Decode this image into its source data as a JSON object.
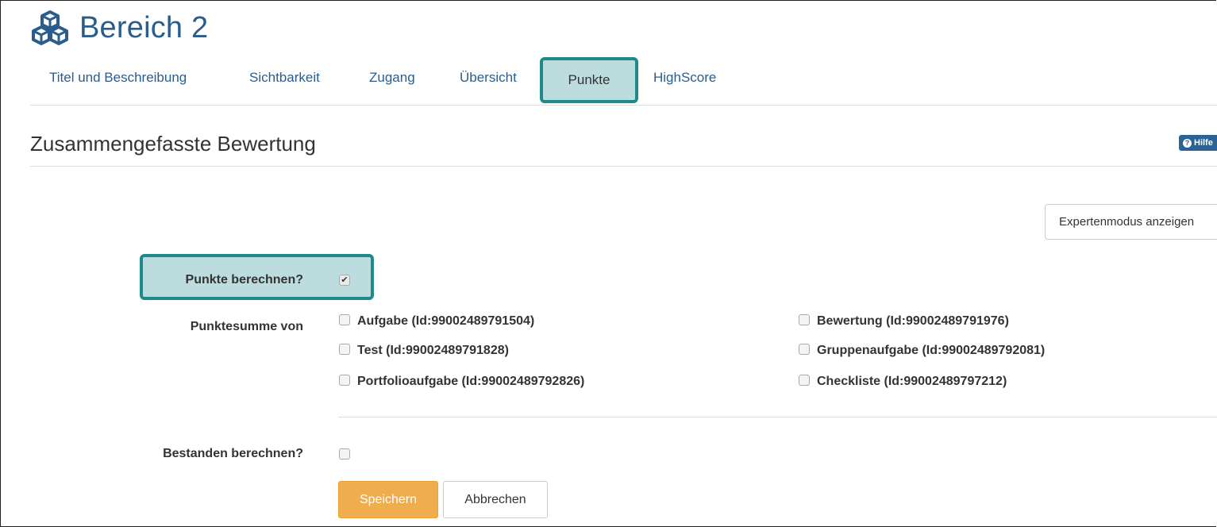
{
  "header": {
    "title": "Bereich 2",
    "icon": "cubes-icon"
  },
  "tabs": [
    {
      "label": "Titel und Beschreibung"
    },
    {
      "label": "Sichtbarkeit"
    },
    {
      "label": "Zugang"
    },
    {
      "label": "Übersicht"
    },
    {
      "label": "Punkte"
    },
    {
      "label": "HighScore"
    }
  ],
  "active_tab": "Punkte",
  "section": {
    "title": "Zusammengefasste Bewertung",
    "help_label": "Hilfe"
  },
  "expert_button": "Expertenmodus anzeigen",
  "form": {
    "calc_points_label": "Punkte berechnen?",
    "calc_points_checked": true,
    "sum_label": "Punktesumme von",
    "options": [
      {
        "label": "Aufgabe (Id:99002489791504)",
        "checked": false
      },
      {
        "label": "Test (Id:99002489791828)",
        "checked": false
      },
      {
        "label": "Portfolioaufgabe (Id:99002489792826)",
        "checked": false
      },
      {
        "label": "Bewertung (Id:99002489791976)",
        "checked": false
      },
      {
        "label": "Gruppenaufgabe (Id:99002489792081)",
        "checked": false
      },
      {
        "label": "Checkliste (Id:99002489797212)",
        "checked": false
      }
    ],
    "calc_passed_label": "Bestanden berechnen?",
    "calc_passed_checked": false
  },
  "buttons": {
    "save": "Speichern",
    "cancel": "Abbrechen"
  },
  "colors": {
    "accent": "#2a5d8c",
    "highlight": "#1f8a8a",
    "save": "#f0ad4e"
  }
}
